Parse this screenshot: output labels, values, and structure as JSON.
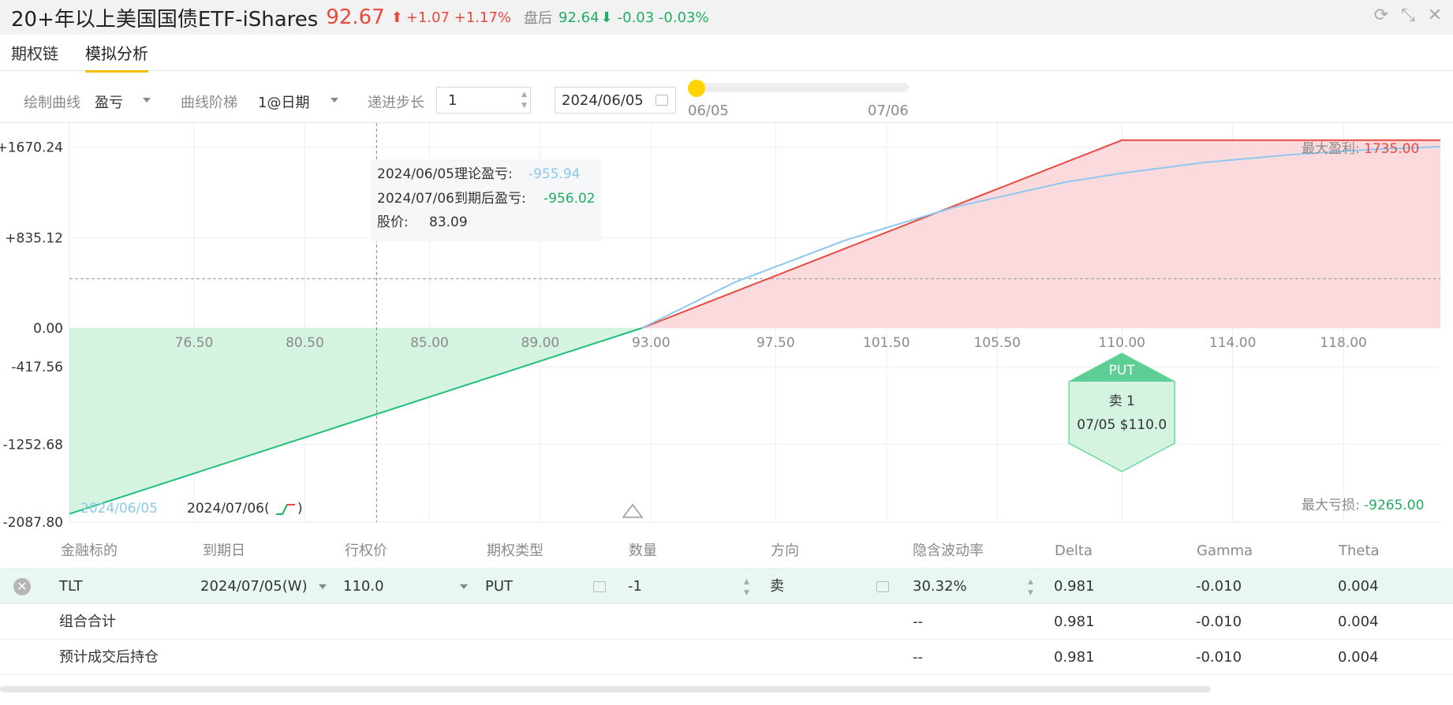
{
  "header": {
    "title": "20+年以上美国国债ETF-iShares",
    "price": "92.67",
    "price_arrow": "⬆",
    "change": "+1.07 +1.17%",
    "after_label": "盘后",
    "after_price": "92.64",
    "after_arrow": "⬇",
    "after_change": "-0.03 -0.03%"
  },
  "window_icons": [
    "refresh-icon",
    "collapse-icon",
    "close-icon"
  ],
  "tabs": [
    {
      "label": "期权链",
      "active": false
    },
    {
      "label": "模拟分析",
      "active": true
    }
  ],
  "controls": {
    "curve_label": "绘制曲线",
    "curve_value": "盈亏",
    "step_label": "曲线阶梯",
    "step_value": "1@日期",
    "increment_label": "递进步长",
    "increment_value": "1",
    "date_value": "2024/06/05",
    "slider_start": "06/05",
    "slider_end": "07/06",
    "slider_position": 0
  },
  "chart_data": {
    "type": "area",
    "xlim": [
      72.0,
      121.5
    ],
    "ylim": [
      -2087.8,
      2087.8
    ],
    "x_ticks": [
      "76.50",
      "80.50",
      "85.00",
      "89.00",
      "93.00",
      "97.50",
      "101.50",
      "105.50",
      "110.00",
      "114.00",
      "118.00"
    ],
    "y_ticks": [
      "+1670.24",
      "+835.12",
      "0.00",
      "-417.56",
      "-1252.68",
      "-2087.80"
    ],
    "series": [
      {
        "name": "2024/07/06",
        "color": "#e8493f",
        "x": [
          72.0,
          92.67,
          110.0,
          121.5
        ],
        "y": [
          -2000.0,
          0.0,
          1735.0,
          1735.0
        ]
      },
      {
        "name": "2024/06/05",
        "color": "#8cc8f0",
        "x": [
          92.67,
          96.0,
          100.0,
          104.0,
          108.0,
          110.0,
          113.0,
          116.0,
          119.0,
          121.5
        ],
        "y": [
          0.0,
          420.0,
          810.0,
          1120.0,
          1350.0,
          1430.0,
          1530.0,
          1600.0,
          1650.0,
          1675.0
        ]
      }
    ],
    "breakeven_y": 455,
    "crosshair_x": 83.09,
    "tooltip": {
      "theory_label": "2024/06/05理论盈亏:",
      "theory_value": "-955.94",
      "expiry_label": "2024/07/06到期后盈亏:",
      "expiry_value": "-956.02",
      "price_label": "股价:",
      "price_value": "83.09"
    },
    "max_profit_label": "最大盈利:",
    "max_profit_value": "1735.00",
    "max_loss_label": "最大亏损:",
    "max_loss_value": "-9265.00",
    "legend_date1": "2024/06/05",
    "legend_date2": "2024/07/06(",
    "legend_date2_close": ")",
    "marker": {
      "strike": 110.0,
      "type": "PUT",
      "line1": "卖 1",
      "line2": "07/05 $110.0"
    },
    "colors": {
      "profit_fill": "#fadadd",
      "loss_fill": "#d4f3e1",
      "profit_line": "#e8493f",
      "loss_line": "#22c07a",
      "theory_line": "#8cc8f0"
    }
  },
  "table": {
    "headers": [
      "金融标的",
      "到期日",
      "行权价",
      "期权类型",
      "数量",
      "方向",
      "隐含波动率",
      "Delta",
      "Gamma",
      "Theta"
    ],
    "position": {
      "symbol": "TLT",
      "expiry": "2024/07/05(W)",
      "strike": "110.0",
      "type": "PUT",
      "quantity": "-1",
      "direction": "卖",
      "iv": "30.32%",
      "delta": "0.981",
      "gamma": "-0.010",
      "theta": "0.004"
    },
    "combo": {
      "label": "组合合计",
      "iv": "--",
      "delta": "0.981",
      "gamma": "-0.010",
      "theta": "0.004"
    },
    "projected": {
      "label": "预计成交后持仓",
      "iv": "--",
      "delta": "0.981",
      "gamma": "-0.010",
      "theta": "0.004"
    }
  }
}
